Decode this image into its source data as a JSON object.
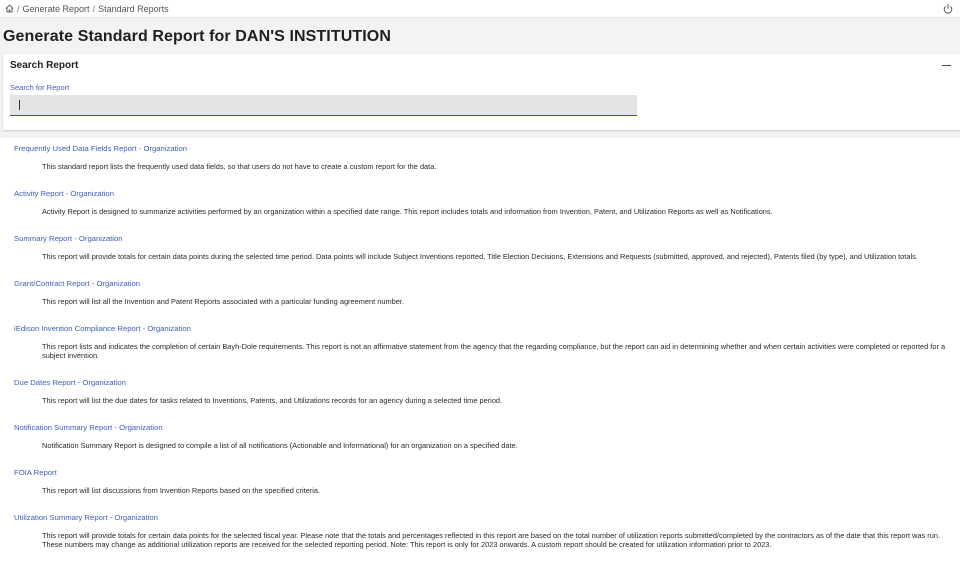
{
  "breadcrumb": {
    "items": [
      "Generate Report",
      "Standard Reports"
    ],
    "separator": "/"
  },
  "page": {
    "title": "Generate Standard Report for DAN'S INSTITUTION"
  },
  "search": {
    "panel_title": "Search Report",
    "label": "Search for Report",
    "value": ""
  },
  "reports": [
    {
      "title": "Frequently Used Data Fields Report - Organization",
      "description": "This standard report lists the frequently used data fields, so that users do not have to create a custom report for the data."
    },
    {
      "title": "Activity Report - Organization",
      "description": "Activity Report is designed to summarize activities performed by an organization within a specified date range. This report includes totals and information from Invention, Patent, and Utilization Reports as well as Notifications."
    },
    {
      "title": "Summary Report - Organization",
      "description": "This report will provide totals for certain data points during the selected time period. Data points will include Subject Inventions reported, Title Election Decisions, Extensions and Requests (submitted, approved, and rejected), Patents filed (by type), and Utilization totals."
    },
    {
      "title": "Grant/Contract Report - Organization",
      "description": "This report will list all the Invention and Patent Reports associated with a particular funding agreement number."
    },
    {
      "title": "iEdison Invention Compliance Report - Organization",
      "description": "This report lists and indicates the completion of certain Bayh-Dole requirements. This report is not an affirmative statement from the agency that the regarding compliance, but the report can aid in determining whether and when certain activities were completed or reported for a subject invention."
    },
    {
      "title": "Due Dates Report - Organization",
      "description": "This report will list the due dates for tasks related to Inventions, Patents, and Utilizations records for an agency during a selected time period."
    },
    {
      "title": "Notification Summary Report - Organization",
      "description": "Notification Summary Report is designed to compile a list of all notifications (Actionable and Informational) for an organization on a specified date."
    },
    {
      "title": "FOIA Report",
      "description": "This report will list discussions from Invention Reports based on the specified criteria."
    },
    {
      "title": "Utilization Summary Report - Organization",
      "description": "This report will provide totals for certain data points for the selected fiscal year. Please note that the totals and percentages reflected in this report are based on the total number of utilization reports submitted/completed by the contractors as of the date that this report was run. These numbers may change as additional utilization reports are received for the selected reporting period. Note: This report is only for 2023 onwards. A custom report should be created for utilization information prior to 2023."
    }
  ],
  "icons": {
    "home": "home-icon",
    "power": "power-icon",
    "collapse": "minus-icon"
  },
  "colors": {
    "link": "#3f5fb8",
    "input_underline": "#3c4cb0"
  }
}
